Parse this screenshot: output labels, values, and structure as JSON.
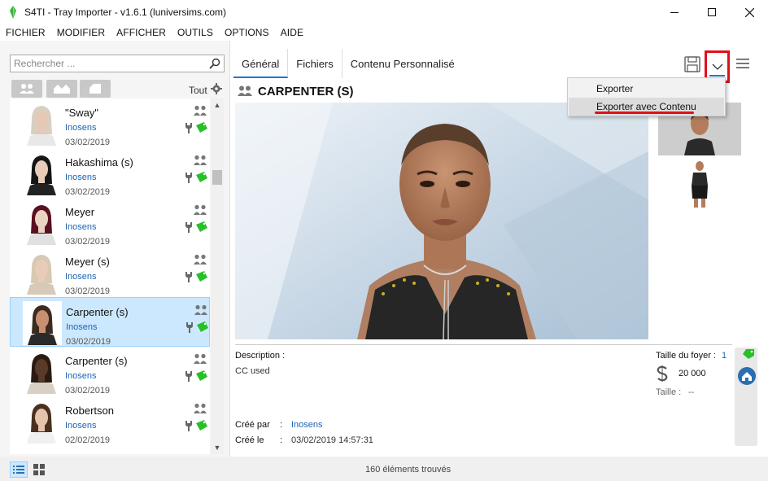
{
  "window": {
    "title": "S4TI - Tray Importer - v1.6.1  (luniversims.com)"
  },
  "menu": [
    "FICHIER",
    "MODIFIER",
    "AFFICHER",
    "OUTILS",
    "OPTIONS",
    "AIDE"
  ],
  "sidebar": {
    "search_placeholder": "Rechercher ...",
    "filter_label": "Tout",
    "items": [
      {
        "name": "\"Sway\"",
        "creator": "Inosens",
        "date": "03/02/2019",
        "hair": "#d8cfc0",
        "skin": "#e6c9b5",
        "top": "#e8e8e8"
      },
      {
        "name": "Hakashima (s)",
        "creator": "Inosens",
        "date": "03/02/2019",
        "hair": "#151515",
        "skin": "#e9cdb8",
        "top": "#222222"
      },
      {
        "name": "Meyer",
        "creator": "Inosens",
        "date": "03/02/2019",
        "hair": "#5a1020",
        "skin": "#ecd2c2",
        "top": "#e0e0e0"
      },
      {
        "name": "Meyer (s)",
        "creator": "Inosens",
        "date": "03/02/2019",
        "hair": "#d7c9b4",
        "skin": "#e8ccb8",
        "top": "#d8c8b8"
      },
      {
        "name": "Carpenter (s)",
        "creator": "Inosens",
        "date": "03/02/2019",
        "hair": "#3a2a20",
        "skin": "#c89070",
        "top": "#2a2a2a",
        "selected": true
      },
      {
        "name": "Carpenter (s)",
        "creator": "Inosens",
        "date": "03/02/2019",
        "hair": "#2a1a12",
        "skin": "#5a3a28",
        "top": "#d8d0c4"
      },
      {
        "name": "Robertson",
        "creator": "Inosens",
        "date": "02/02/2019",
        "hair": "#4a3020",
        "skin": "#e4c4aa",
        "top": "#f0f0f0"
      }
    ]
  },
  "tabs": [
    {
      "label": "Général",
      "active": true
    },
    {
      "label": "Fichiers"
    },
    {
      "label": "Contenu Personnalisé"
    }
  ],
  "detail": {
    "title": "CARPENTER (S)",
    "description_label": "Description :",
    "description": "CC used",
    "created_by_label": "Créé par",
    "created_by": "Inosens",
    "created_on_label": "Créé le",
    "created_on": "03/02/2019 14:57:31",
    "separator": ":",
    "household_label": "Taille du foyer :",
    "household_size": "1",
    "funds": "20 000",
    "size_label": "Taille :",
    "size_value": "--"
  },
  "export_menu": {
    "items": [
      "Exporter",
      "Exporter avec Contenu"
    ]
  },
  "status": {
    "count_text": "160 éléments trouvés"
  },
  "colors": {
    "accent": "#1e78d2",
    "link": "#1e64b4",
    "highlight": "#e0101a",
    "tag_green": "#28c028",
    "selection": "#cce8ff"
  }
}
